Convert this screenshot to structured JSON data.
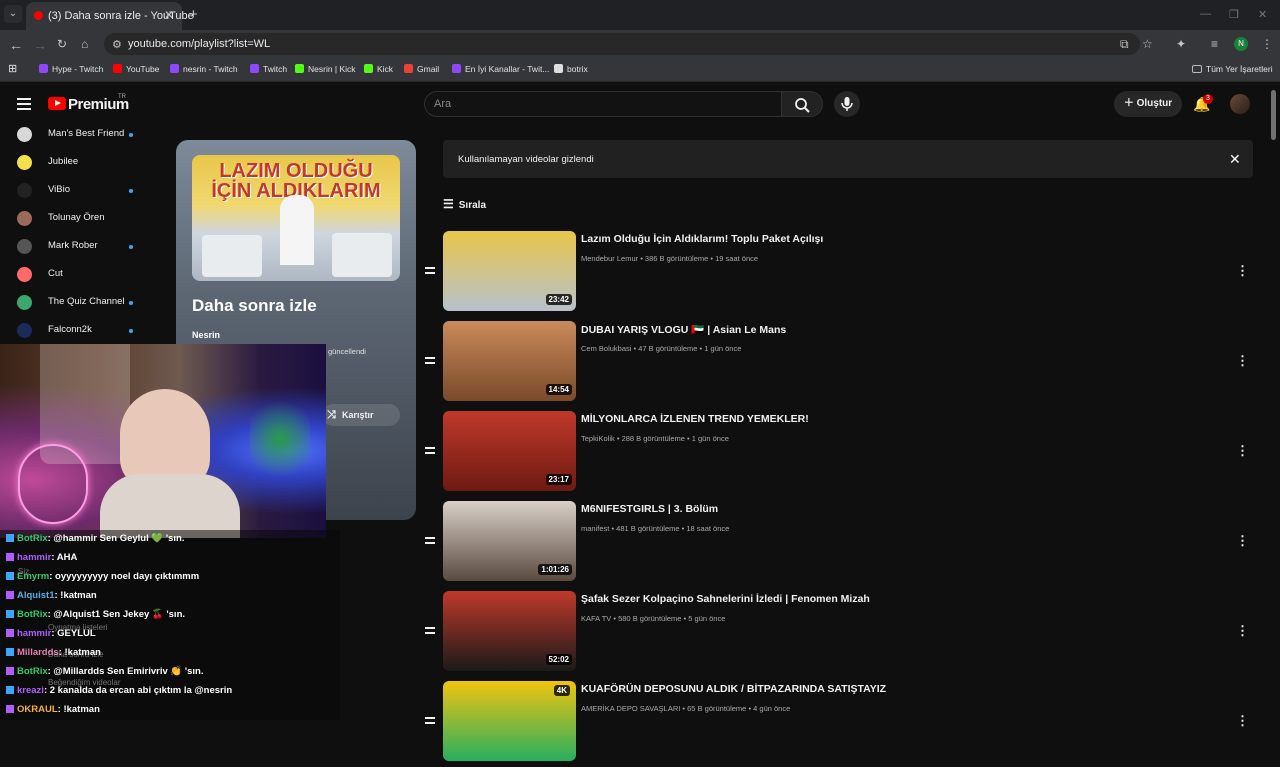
{
  "browser": {
    "tab_title": "(3) Daha sonra izle - YouTube",
    "url": "youtube.com/playlist?list=WL",
    "profile_initial": "N",
    "bookmarks": [
      {
        "label": "Hype - Twitch",
        "color": "#9146ff"
      },
      {
        "label": "YouTube",
        "color": "#ff0000"
      },
      {
        "label": "nesrin - Twitch",
        "color": "#9146ff"
      },
      {
        "label": "Twitch",
        "color": "#9146ff"
      },
      {
        "label": "Nesrin | Kick",
        "color": "#53fc18"
      },
      {
        "label": "Kick",
        "color": "#53fc18"
      },
      {
        "label": "Gmail",
        "color": "#ea4335"
      },
      {
        "label": "En İyi Kanallar - Twit...",
        "color": "#9146ff"
      },
      {
        "label": "botrix",
        "color": "#dddddd"
      }
    ],
    "all_bookmarks_label": "Tüm Yer İşaretleri"
  },
  "yt": {
    "logo_text": "Premium",
    "region": "TR",
    "search_placeholder": "Ara",
    "create_label": "Oluştur",
    "notification_count": "3"
  },
  "sidebar": {
    "subscriptions": [
      {
        "name": "Man's Best Friend",
        "color": "#d8d8d8",
        "new": true
      },
      {
        "name": "Jubilee",
        "color": "#f4e04d",
        "new": false
      },
      {
        "name": "ViBio",
        "color": "#222222",
        "new": true
      },
      {
        "name": "Tolunay Ören",
        "color": "#9a6a5a",
        "new": false
      },
      {
        "name": "Mark Rober",
        "color": "#555555",
        "new": true
      },
      {
        "name": "Cut",
        "color": "#ff6a6a",
        "new": false
      },
      {
        "name": "The Quiz Channel",
        "color": "#3aa86b",
        "new": true
      },
      {
        "name": "Falconn2k",
        "color": "#1a2a5a",
        "new": true
      }
    ]
  },
  "playlist": {
    "title": "Daha sonra izle",
    "owner": "Nesrin",
    "updated_fragment": "güncellendi",
    "shuffle_label": "Karıştır",
    "thumb_text": "LAZIM OLDUĞU İÇİN ALDIKLARIM"
  },
  "chat": {
    "messages": [
      {
        "user": "BotRix",
        "text": ": @hammir Sen Geylul 💚 'sın.",
        "color": "#2ecc71"
      },
      {
        "user": "hammir",
        "text": ": AHA",
        "color": "#b05cff"
      },
      {
        "user": "Emyrm",
        "text": ": oyyyyyyyyy noel dayı çıktımmm",
        "color": "#2ecc71"
      },
      {
        "user": "Alquist1",
        "text": ": !katman",
        "color": "#5dade2"
      },
      {
        "user": "BotRix",
        "text": ": @Alquist1 Sen Jekey 🍒 'sın.",
        "color": "#2ecc71"
      },
      {
        "user": "hammir",
        "text": ": GEYLUL",
        "color": "#b05cff"
      },
      {
        "user": "Millardds",
        "text": ": !katman",
        "color": "#e67eb0"
      },
      {
        "user": "BotRix",
        "text": ": @Millardds Sen Emirivriv 👏 'sın.",
        "color": "#2ecc71"
      },
      {
        "user": "kreazi",
        "text": ": 2 kanalda da ercan abi çıktım la @nesrin",
        "color": "#b05cff"
      },
      {
        "user": "OKRAUL",
        "text": ": !katman",
        "color": "#f5b041"
      }
    ],
    "ghost_labels": [
      "Siz",
      "Oynatma listeleri",
      "Daha sonra izle",
      "Beğendiğim videolar"
    ]
  },
  "list": {
    "notice": "Kullanılamayan videolar gizlendi",
    "sort_label": "Sırala",
    "videos": [
      {
        "title": "Lazım Olduğu İçin Aldıklarım! Toplu Paket Açılışı",
        "channel": "Mendebur Lemur",
        "views": "386 B görüntüleme",
        "age": "19 saat önce",
        "duration": "23:42",
        "thumb_top": "#e8c64a",
        "thumb_bottom": "#b7c1cb",
        "badge": ""
      },
      {
        "title": "DUBAI YARIŞ VLOGU 🇦🇪 | Asian Le Mans",
        "channel": "Cem Bolukbasi",
        "views": "47 B görüntüleme",
        "age": "1 gün önce",
        "duration": "14:54",
        "thumb_top": "#c98a5a",
        "thumb_bottom": "#7a4a2a",
        "badge": ""
      },
      {
        "title": "MİLYONLARCA İZLENEN TREND YEMEKLER!",
        "channel": "TepkiKolik",
        "views": "288 B görüntüleme",
        "age": "1 gün önce",
        "duration": "23:17",
        "thumb_top": "#c0392b",
        "thumb_bottom": "#6e1a12",
        "badge": ""
      },
      {
        "title": "M6NIFESTGIRLS | 3. Bölüm",
        "channel": "manifest",
        "views": "481 B görüntüleme",
        "age": "18 saat önce",
        "duration": "1:01:26",
        "thumb_top": "#d8d0c8",
        "thumb_bottom": "#5a4a40",
        "badge": ""
      },
      {
        "title": "Şafak Sezer Kolpaçino Sahnelerini İzledi | Fenomen Mizah",
        "channel": "KAFA TV",
        "views": "580 B görüntüleme",
        "age": "5 gün önce",
        "duration": "52:02",
        "thumb_top": "#c0392b",
        "thumb_bottom": "#1a1a1a",
        "badge": ""
      },
      {
        "title": "KUAFÖRÜN DEPOSUNU ALDIK / BİTPAZARINDA SATIŞTAYIZ",
        "channel": "AMERİKA DEPO SAVAŞLARI",
        "views": "65 B görüntüleme",
        "age": "4 gün önce",
        "duration": "",
        "thumb_top": "#f1c40f",
        "thumb_bottom": "#27ae60",
        "badge": "4K"
      }
    ]
  }
}
